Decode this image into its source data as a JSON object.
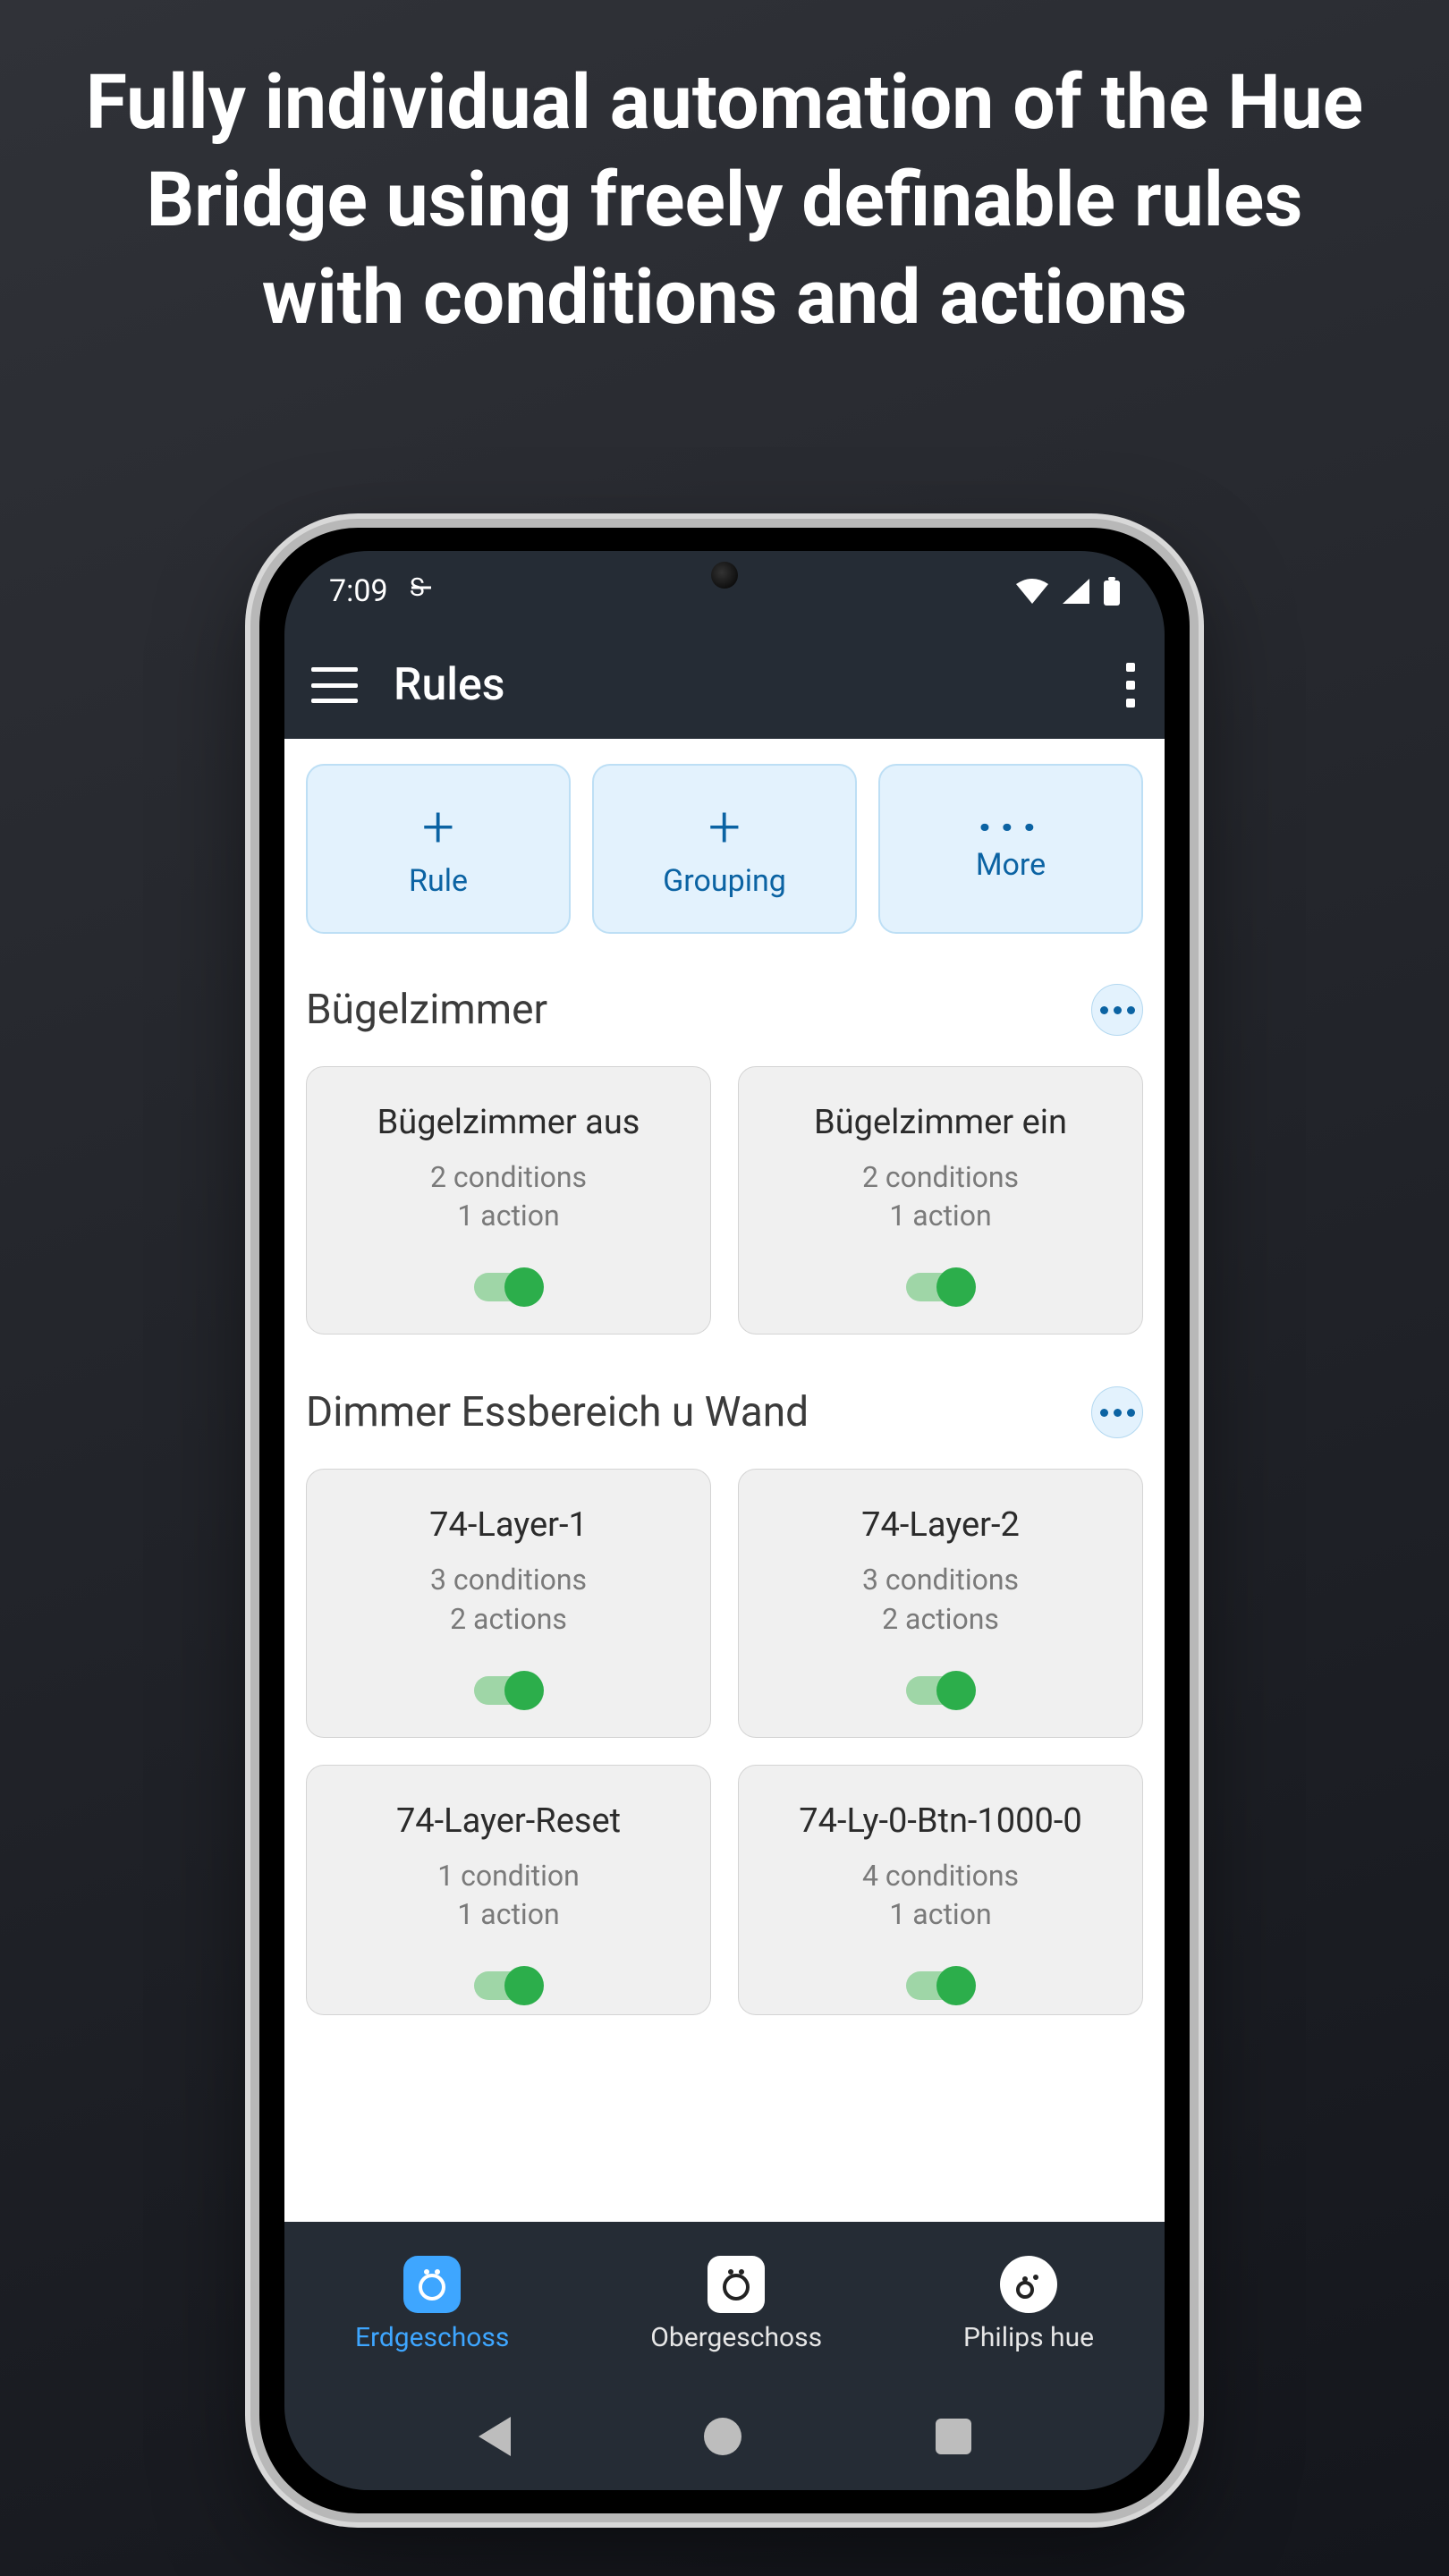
{
  "headline": "Fully individual automation of the Hue Bridge using freely definable rules with conditions and actions",
  "statusbar": {
    "time": "7:09"
  },
  "appbar": {
    "title": "Rules"
  },
  "actions": {
    "rule": "Rule",
    "grouping": "Grouping",
    "more": "More"
  },
  "groups": [
    {
      "title": "Bügelzimmer",
      "rules": [
        {
          "title": "Bügelzimmer aus",
          "conditions": "2 conditions",
          "actions": "1 action",
          "enabled": true
        },
        {
          "title": "Bügelzimmer ein",
          "conditions": "2 conditions",
          "actions": "1 action",
          "enabled": true
        }
      ]
    },
    {
      "title": "Dimmer Essbereich u Wand",
      "rules": [
        {
          "title": "74-Layer-1",
          "conditions": "3 conditions",
          "actions": "2 actions",
          "enabled": true
        },
        {
          "title": "74-Layer-2",
          "conditions": "3 conditions",
          "actions": "2 actions",
          "enabled": true
        },
        {
          "title": "74-Layer-Reset",
          "conditions": "1 condition",
          "actions": "1 action",
          "enabled": true
        },
        {
          "title": "74-Ly-0-Btn-1000-0",
          "conditions": "4 conditions",
          "actions": "1 action",
          "enabled": true
        }
      ]
    }
  ],
  "bottomnav": {
    "tab1": "Erdgeschoss",
    "tab2": "Obergeschoss",
    "tab3": "Philips hue"
  }
}
